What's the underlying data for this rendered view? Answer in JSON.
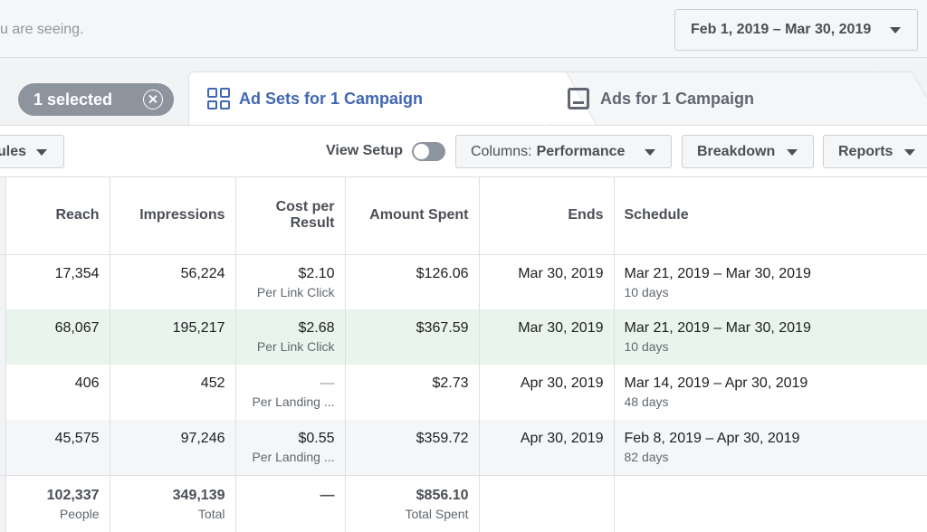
{
  "top": {
    "hint": "u are seeing.",
    "date_range": "Feb 1, 2019 – Mar 30, 2019"
  },
  "tabs": {
    "selected_pill": "1 selected",
    "ad_sets_label": "Ad Sets for 1 Campaign",
    "ads_label": "Ads for 1 Campaign"
  },
  "toolbar": {
    "rules_label": "ules",
    "view_setup_label": "View Setup",
    "view_setup_on": false,
    "columns_prefix": "Columns:",
    "columns_value": "Performance",
    "breakdown_label": "Breakdown",
    "reports_label": "Reports"
  },
  "table": {
    "headers": {
      "reach": "Reach",
      "impressions": "Impressions",
      "cost_line1": "Cost per",
      "cost_line2": "Result",
      "amount": "Amount Spent",
      "ends": "Ends",
      "schedule": "Schedule"
    },
    "rows": [
      {
        "reach": "17,354",
        "impressions": "56,224",
        "cost": "$2.10",
        "cost_sub": "Per Link Click",
        "amount": "$126.06",
        "ends": "Mar 30, 2019",
        "schedule": "Mar 21, 2019 – Mar 30, 2019",
        "schedule_sub": "10 days"
      },
      {
        "reach": "68,067",
        "impressions": "195,217",
        "cost": "$2.68",
        "cost_sub": "Per Link Click",
        "amount": "$367.59",
        "ends": "Mar 30, 2019",
        "schedule": "Mar 21, 2019 – Mar 30, 2019",
        "schedule_sub": "10 days"
      },
      {
        "reach": "406",
        "impressions": "452",
        "cost": "—",
        "cost_sub": "Per Landing ...",
        "amount": "$2.73",
        "ends": "Apr 30, 2019",
        "schedule": "Mar 14, 2019 – Apr 30, 2019",
        "schedule_sub": "48 days"
      },
      {
        "reach": "45,575",
        "impressions": "97,246",
        "cost": "$0.55",
        "cost_sub": "Per Landing ...",
        "amount": "$359.72",
        "ends": "Apr 30, 2019",
        "schedule": "Feb 8, 2019 – Apr 30, 2019",
        "schedule_sub": "82 days"
      }
    ],
    "totals": {
      "reach": "102,337",
      "reach_sub": "People",
      "impressions": "349,139",
      "impressions_sub": "Total",
      "cost": "—",
      "amount": "$856.10",
      "amount_sub": "Total Spent"
    }
  },
  "colors": {
    "accent": "#4267b2",
    "highlight_row": "#e9f5ec",
    "pill": "#8d949e"
  }
}
